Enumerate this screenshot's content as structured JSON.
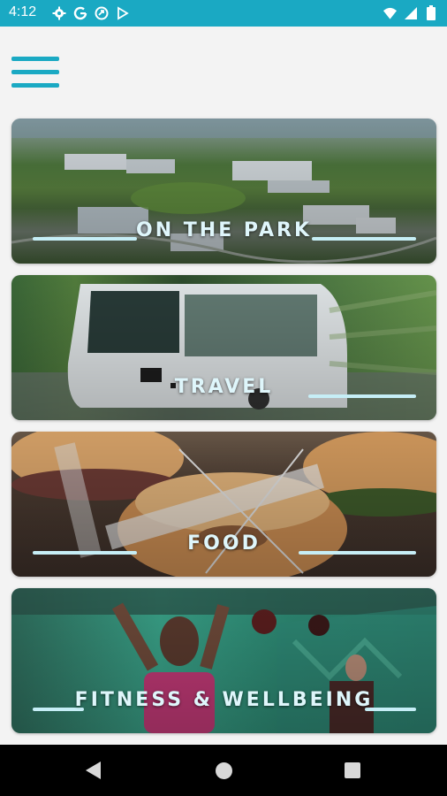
{
  "status_bar": {
    "time": "4:12",
    "left_icons": [
      "gear-icon",
      "google-icon",
      "sync-icon",
      "play-store-icon"
    ],
    "right_icons": [
      "wifi-icon",
      "signal-icon",
      "battery-icon"
    ]
  },
  "menu": {
    "icon": "hamburger-menu-icon"
  },
  "tiles": [
    {
      "label": "ON THE PARK"
    },
    {
      "label": "TRAVEL"
    },
    {
      "label": "FOOD"
    },
    {
      "label": "FITNESS & WELLBEING"
    }
  ],
  "navigation": {
    "back_icon": "back-icon",
    "home_icon": "home-icon",
    "recents_icon": "recents-icon"
  },
  "colors": {
    "accent": "#1aa9c3",
    "label": "#dff6fb",
    "nav_bar": "#000000"
  }
}
